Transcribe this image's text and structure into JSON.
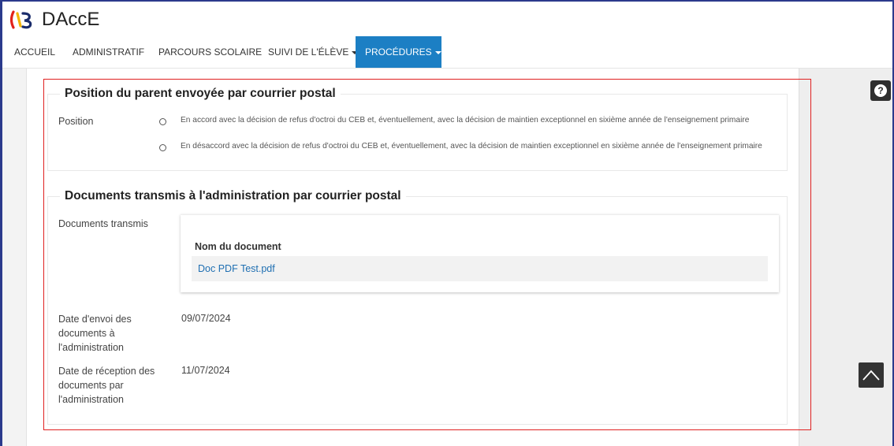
{
  "app": {
    "title": "DAccE"
  },
  "nav": {
    "items": [
      {
        "label": "ACCUEIL"
      },
      {
        "label": "ADMINISTRATIF"
      },
      {
        "label": "PARCOURS SCOLAIRE"
      },
      {
        "label": "SUIVI DE L'ÉLÈVE"
      },
      {
        "label": "PROCÉDURES"
      }
    ]
  },
  "position_section": {
    "title": "Position du parent envoyée par courrier postal",
    "field_label": "Position",
    "options": [
      {
        "text": "En accord avec la décision de refus d'octroi du CEB et, éventuellement, avec la décision de maintien exceptionnel en sixième année de l'enseignement primaire"
      },
      {
        "text": "En désaccord avec la décision de refus d'octroi du CEB et, éventuellement, avec la décision de maintien exceptionnel en sixième année de l'enseignement primaire"
      }
    ]
  },
  "documents_section": {
    "title": "Documents transmis à l'administration par courrier postal",
    "documents_label": "Documents transmis",
    "table_header": "Nom du document",
    "documents": [
      {
        "name": "Doc PDF Test.pdf"
      }
    ],
    "send_date_label": "Date d'envoi des documents à l'administration",
    "send_date": "09/07/2024",
    "receive_date_label": "Date de réception des documents par l'administration",
    "receive_date": "11/07/2024"
  },
  "colors": {
    "accent": "#1c7fc4",
    "highlight": "#e02020",
    "link": "#1f6fb2"
  },
  "icons": {
    "help": "question-circle-icon",
    "back_to_top": "chevron-up-icon"
  }
}
